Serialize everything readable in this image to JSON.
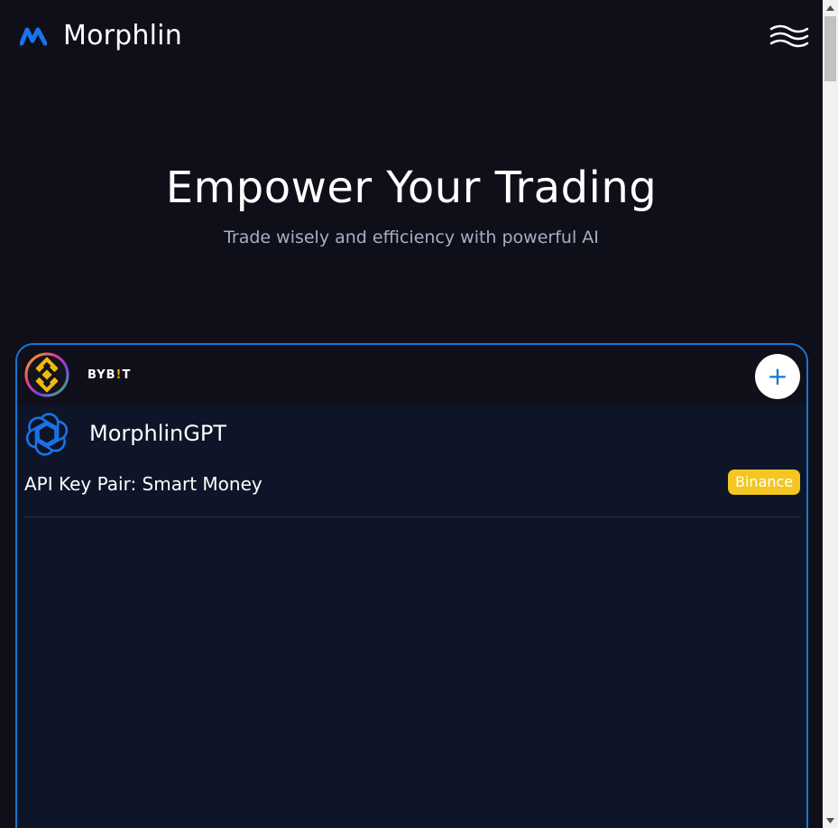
{
  "header": {
    "brand": "Morphlin"
  },
  "hero": {
    "title": "Empower Your Trading",
    "subtitle": "Trade wisely and efficiency with powerful AI"
  },
  "card": {
    "exchange_logo_1": "binance-logo",
    "exchange_logo_2_text": "BYB",
    "exchange_logo_2_mark": "!",
    "exchange_logo_2_tail": "T",
    "add_label": "+",
    "bot_name": "MorphlinGPT",
    "api_key_label": "API Key Pair: Smart Money",
    "exchange_badge": "Binance"
  },
  "colors": {
    "background": "#0f0f1a",
    "card_bg": "#0e1528",
    "accent": "#1677d6",
    "badge": "#f3c623"
  }
}
